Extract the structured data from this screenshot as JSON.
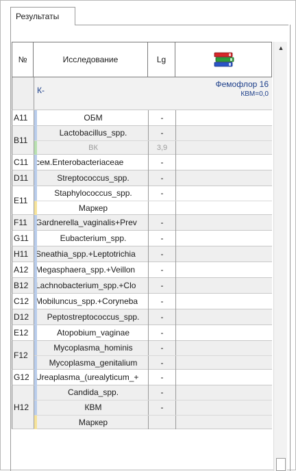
{
  "tab": {
    "label": "Результаты"
  },
  "header": {
    "num": "№",
    "study": "Исследование",
    "lg": "Lg"
  },
  "k_row": {
    "label": "К-",
    "title": "Фемофлор 16",
    "subtitle": "КВМ=0,0"
  },
  "rows": [
    {
      "id": "A11",
      "items": [
        {
          "name": "ОБМ",
          "lg": "-",
          "marker": "blue"
        }
      ]
    },
    {
      "id": "B11",
      "items": [
        {
          "name": "Lactobacillus_spp.",
          "lg": "-",
          "marker": "blue"
        },
        {
          "name": "ВК",
          "lg": "3,9",
          "marker": "green",
          "muted": true
        }
      ]
    },
    {
      "id": "C11",
      "items": [
        {
          "name": "сем.Enterobacteriaceae",
          "lg": "-",
          "marker": "blue",
          "left": true
        }
      ]
    },
    {
      "id": "D11",
      "items": [
        {
          "name": "Streptococcus_spp.",
          "lg": "-",
          "marker": "blue"
        }
      ]
    },
    {
      "id": "E11",
      "items": [
        {
          "name": "Staphylococcus_spp.",
          "lg": "-",
          "marker": "blue"
        },
        {
          "name": "Маркер",
          "lg": "",
          "marker": "yellow"
        }
      ]
    },
    {
      "id": "F11",
      "items": [
        {
          "name": "Gardnerella_vaginalis+Prev",
          "lg": "-",
          "marker": "blue",
          "left": true
        }
      ]
    },
    {
      "id": "G11",
      "items": [
        {
          "name": "Eubacterium_spp.",
          "lg": "-",
          "marker": "blue"
        }
      ]
    },
    {
      "id": "H11",
      "items": [
        {
          "name": "Sneathia_spp.+Leptotrichia",
          "lg": "-",
          "marker": "blue",
          "left": true
        }
      ]
    },
    {
      "id": "A12",
      "items": [
        {
          "name": "Megasphaera_spp.+Veillon",
          "lg": "-",
          "marker": "blue",
          "left": true
        }
      ]
    },
    {
      "id": "B12",
      "items": [
        {
          "name": "Lachnobacterium_spp.+Clo",
          "lg": "-",
          "marker": "blue",
          "left": true
        }
      ]
    },
    {
      "id": "C12",
      "items": [
        {
          "name": "Mobiluncus_spp.+Coryneba",
          "lg": "-",
          "marker": "blue",
          "left": true
        }
      ]
    },
    {
      "id": "D12",
      "items": [
        {
          "name": "Peptostreptococcus_spp.",
          "lg": "-",
          "marker": "blue"
        }
      ]
    },
    {
      "id": "E12",
      "items": [
        {
          "name": "Atopobium_vaginae",
          "lg": "-",
          "marker": "blue"
        }
      ]
    },
    {
      "id": "F12",
      "items": [
        {
          "name": "Mycoplasma_hominis",
          "lg": "-",
          "marker": "blue"
        },
        {
          "name": "Mycoplasma_genitalium",
          "lg": "-",
          "marker": "blue"
        }
      ]
    },
    {
      "id": "G12",
      "items": [
        {
          "name": "Ureaplasma_(urealyticum_+",
          "lg": "-",
          "marker": "blue",
          "left": true
        }
      ]
    },
    {
      "id": "H12",
      "items": [
        {
          "name": "Candida_spp.",
          "lg": "-",
          "marker": "blue"
        },
        {
          "name": "КВМ",
          "lg": "-",
          "marker": "blue"
        },
        {
          "name": "Маркер",
          "lg": "",
          "marker": "yellow"
        }
      ]
    }
  ],
  "colors": {
    "marker_blue": "#b9cdec",
    "marker_green": "#b8e0b0",
    "marker_yellow": "#f6e39a",
    "k_text": "#1d3f8a"
  },
  "icons": {
    "header_result_icon": "books-icon",
    "scroll_up": "scroll-up-arrow-icon"
  }
}
